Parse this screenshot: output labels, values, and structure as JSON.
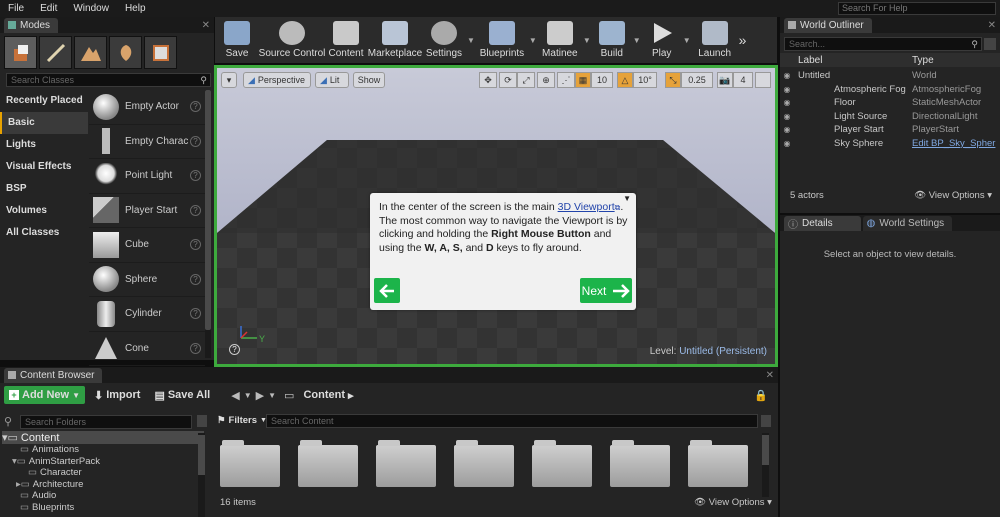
{
  "menu": {
    "items": [
      "File",
      "Edit",
      "Window",
      "Help"
    ],
    "search_placeholder": "Search For Help"
  },
  "modes": {
    "tab": "Modes",
    "search_placeholder": "Search Classes",
    "categories": [
      "Recently Placed",
      "Basic",
      "Lights",
      "Visual Effects",
      "BSP",
      "Volumes",
      "All Classes"
    ],
    "items": [
      "Empty Actor",
      "Empty Charac",
      "Point Light",
      "Player Start",
      "Cube",
      "Sphere",
      "Cylinder",
      "Cone"
    ]
  },
  "toolbar": {
    "buttons": [
      "Save",
      "Source Control",
      "Content",
      "Marketplace",
      "Settings",
      "Blueprints",
      "Matinee",
      "Build",
      "Play",
      "Launch"
    ]
  },
  "viewport": {
    "perspective": "Perspective",
    "lit": "Lit",
    "show": "Show",
    "grid": "10",
    "angle": "10°",
    "scale": "0.25",
    "cam": "4",
    "level_label": "Level:",
    "level_name": "Untitled (Persistent)",
    "axis_y": "Y",
    "tutorial": {
      "t1": "In the center of the screen is the main ",
      "link": "3D Viewport",
      "t2": ". The most common way to navigate the Viewport is by clicking and holding the ",
      "b1": "Right Mouse Button",
      "t3": " and using the ",
      "b2": "W, A, S,",
      "t4": " and ",
      "b3": "D",
      "t5": " keys to fly around.",
      "next": "Next"
    }
  },
  "outliner": {
    "tab": "World Outliner",
    "search_placeholder": "Search...",
    "col_label": "Label",
    "col_type": "Type",
    "rows": [
      {
        "label": "Untitled",
        "type": "World"
      },
      {
        "label": "Atmospheric Fog",
        "type": "AtmosphericFog"
      },
      {
        "label": "Floor",
        "type": "StaticMeshActor"
      },
      {
        "label": "Light Source",
        "type": "DirectionalLight"
      },
      {
        "label": "Player Start",
        "type": "PlayerStart"
      },
      {
        "label": "Sky Sphere",
        "type": "Edit BP_Sky_Spher"
      }
    ],
    "count": "5 actors",
    "view_options": "View Options"
  },
  "details": {
    "tab": "Details",
    "tab2": "World Settings",
    "empty": "Select an object to view details."
  },
  "content_browser": {
    "tab": "Content Browser",
    "add_new": "Add New",
    "import": "Import",
    "save_all": "Save All",
    "path": "Content",
    "search_folders": "Search Folders",
    "filters": "Filters",
    "search_content": "Search Content",
    "tree": [
      "Content",
      "Animations",
      "AnimStarterPack",
      "Character",
      "Architecture",
      "Audio",
      "Blueprints"
    ],
    "count": "16 items",
    "view_options": "View Options"
  }
}
